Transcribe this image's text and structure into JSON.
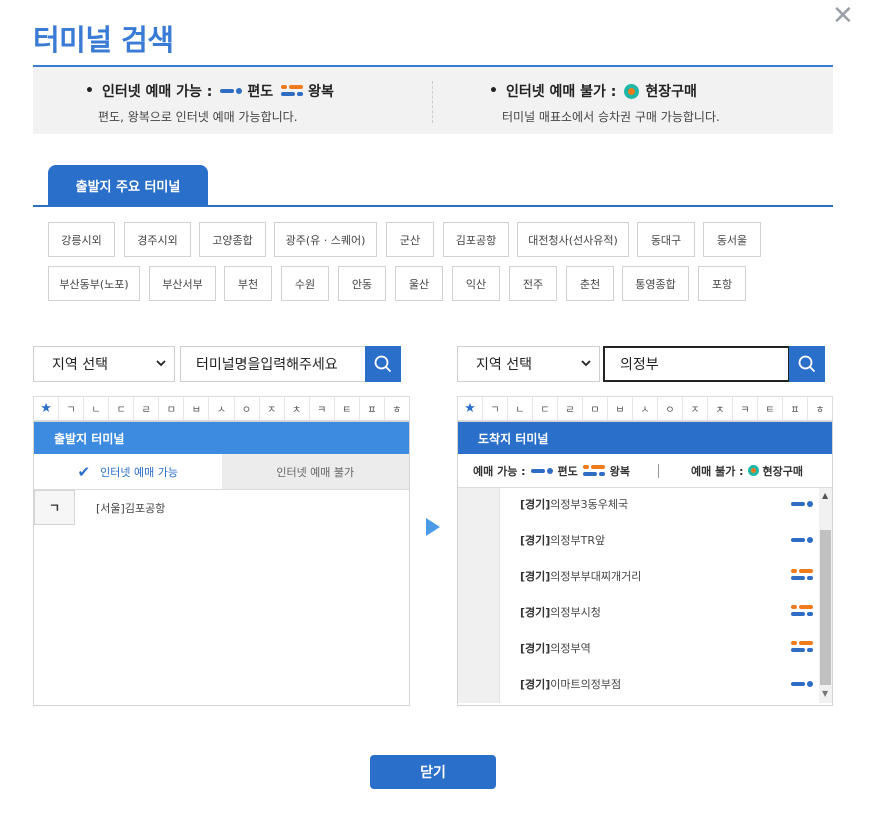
{
  "title": "터미널 검색",
  "close_icon": "close-x-icon",
  "info": {
    "online_label": "인터넷 예매 가능 :",
    "oneway_label": "편도",
    "round_label": "왕복",
    "online_desc": "편도, 왕복으로 인터넷 예매 가능합니다.",
    "offline_label": "인터넷 예매 불가 :",
    "onsite_label": "현장구매",
    "offline_desc": "터미널 매표소에서 승차권 구매 가능합니다."
  },
  "tab": {
    "main_label": "출발지 주요 터미널"
  },
  "major_terminals": [
    "강릉시외",
    "경주시외",
    "고양종합",
    "광주(유 · 스퀘어)",
    "군산",
    "김포공항",
    "대전청사(선사유적)",
    "동대구",
    "동서울",
    "부산동부(노포)",
    "부산서부",
    "부천",
    "수원",
    "안동",
    "울산",
    "익산",
    "전주",
    "춘천",
    "통영종합",
    "포항"
  ],
  "left": {
    "region_select": "지역 선택",
    "search_placeholder": "터미널명을입력해주세요",
    "panel_title": "출발지 터미널",
    "subtab_on": "인터넷 예매 가능",
    "subtab_off": "인터넷 예매 불가",
    "index_letter": "ㄱ",
    "items": [
      "[서울]김포공항"
    ]
  },
  "right": {
    "region_select": "지역 선택",
    "search_value": "의정부",
    "panel_title": "도착지 터미널",
    "legend_online": "예매 가능 :",
    "legend_oneway": "편도",
    "legend_round": "왕복",
    "legend_offline": "예매 불가 :",
    "legend_onsite": "현장구매",
    "items": [
      {
        "region": "[경기]",
        "name": "의정부3동우체국",
        "type": "oneway"
      },
      {
        "region": "[경기]",
        "name": "의정부TR앞",
        "type": "oneway"
      },
      {
        "region": "[경기]",
        "name": "의정부부대찌개거리",
        "type": "round"
      },
      {
        "region": "[경기]",
        "name": "의정부시청",
        "type": "round"
      },
      {
        "region": "[경기]",
        "name": "의정부역",
        "type": "round"
      },
      {
        "region": "[경기]",
        "name": "이마트의정부점",
        "type": "oneway"
      }
    ]
  },
  "consonants": [
    "ㄱ",
    "ㄴ",
    "ㄷ",
    "ㄹ",
    "ㅁ",
    "ㅂ",
    "ㅅ",
    "ㅇ",
    "ㅈ",
    "ㅊ",
    "ㅋ",
    "ㅌ",
    "ㅍ",
    "ㅎ"
  ],
  "close_button": "닫기",
  "colors": {
    "accent": "#2a6fc9",
    "title": "#3a7bd5",
    "oneway": "#2f6dc5",
    "round": "#f07b1d",
    "onsite": "#1fb8a8"
  }
}
